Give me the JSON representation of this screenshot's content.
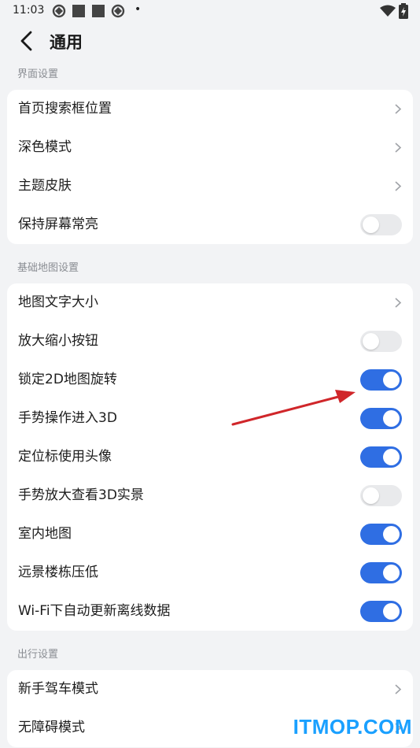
{
  "status_bar": {
    "time": "11:03",
    "dot": "•"
  },
  "header": {
    "title": "通用"
  },
  "sections": [
    {
      "label": "界面设置",
      "items": [
        {
          "label": "首页搜索框位置",
          "control": "chevron"
        },
        {
          "label": "深色模式",
          "control": "chevron"
        },
        {
          "label": "主题皮肤",
          "control": "chevron"
        },
        {
          "label": "保持屏幕常亮",
          "control": "toggle",
          "on": false
        }
      ]
    },
    {
      "label": "基础地图设置",
      "items": [
        {
          "label": "地图文字大小",
          "control": "chevron"
        },
        {
          "label": "放大缩小按钮",
          "control": "toggle",
          "on": false
        },
        {
          "label": "锁定2D地图旋转",
          "control": "toggle",
          "on": true
        },
        {
          "label": "手势操作进入3D",
          "control": "toggle",
          "on": true
        },
        {
          "label": "定位标使用头像",
          "control": "toggle",
          "on": true
        },
        {
          "label": "手势放大查看3D实景",
          "control": "toggle",
          "on": false
        },
        {
          "label": "室内地图",
          "control": "toggle",
          "on": true
        },
        {
          "label": "远景楼栋压低",
          "control": "toggle",
          "on": true
        },
        {
          "label": "Wi-Fi下自动更新离线数据",
          "control": "toggle",
          "on": true
        }
      ]
    },
    {
      "label": "出行设置",
      "items": [
        {
          "label": "新手驾车模式",
          "control": "chevron"
        },
        {
          "label": "无障碍模式",
          "control": "chevron"
        }
      ]
    }
  ],
  "colors": {
    "accent": "#2f6ee3",
    "background": "#f2f3f5",
    "annotation_arrow": "#d0262a",
    "watermark": "#1aa0ff"
  },
  "watermark": "ITMOP.COM"
}
